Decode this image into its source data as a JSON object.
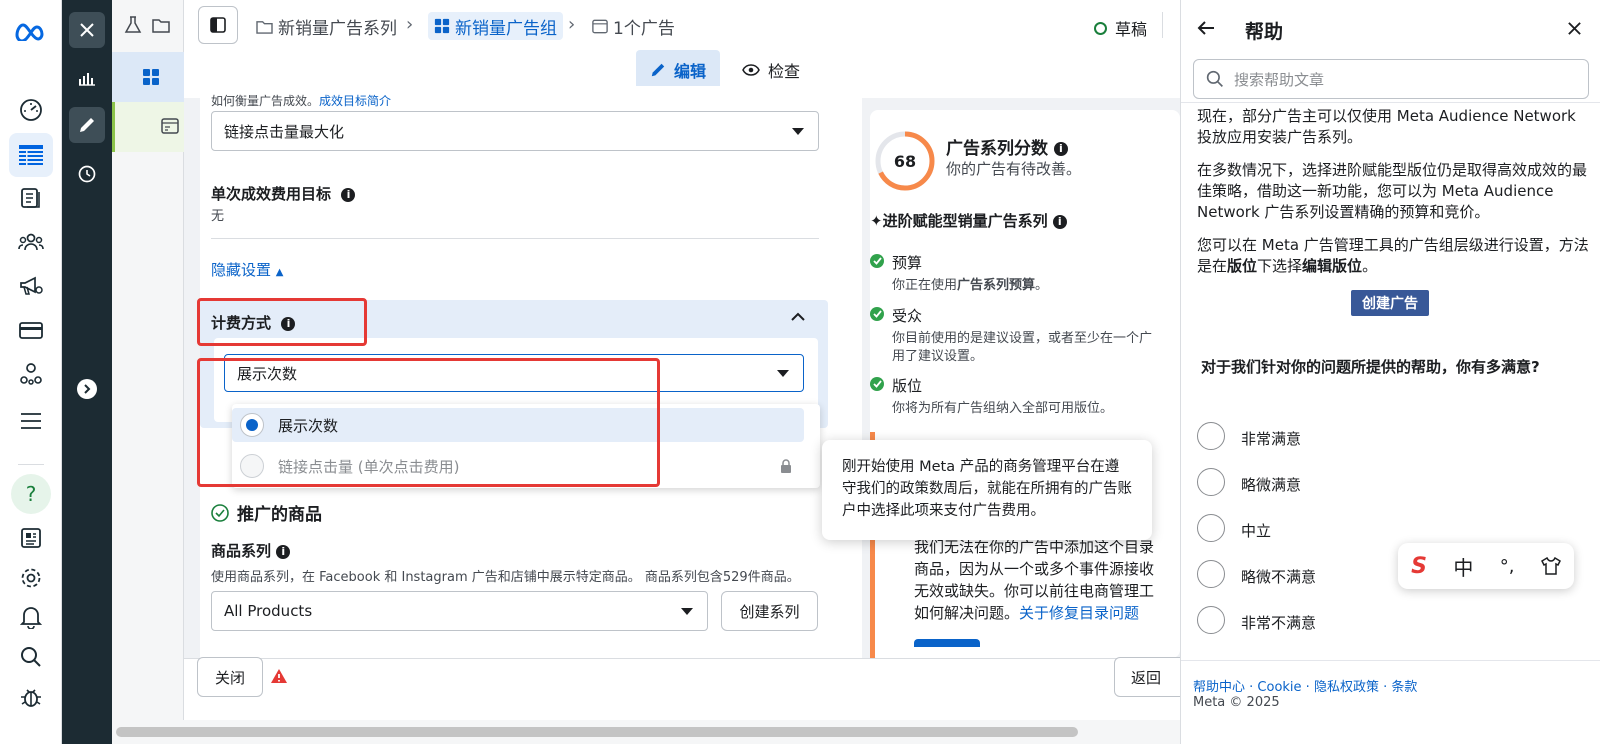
{
  "breadcrumb": {
    "campaign": "新销量广告系列",
    "adset": "新销量广告组",
    "ad": "1个广告"
  },
  "status": {
    "draft": "草稿"
  },
  "tabs": {
    "edit": "编辑",
    "review": "检查"
  },
  "form": {
    "cut_text": "如何衡量广告成效。",
    "cut_link": "成效目标简介",
    "optimization_value": "链接点击量最大化",
    "cost_goal_label": "单次成效费用目标",
    "cost_goal_value": "无",
    "hide_settings": "隐藏设置",
    "billing_label": "计费方式",
    "billing_value": "展示次数",
    "billing_options": [
      "展示次数",
      "链接点击量 (单次点击费用)"
    ],
    "promoted_products": "推广的商品",
    "catalog_label": "商品系列",
    "catalog_desc": "使用商品系列，在 Facebook 和 Instagram 广告和店铺中展示特定商品。 商品系列包含529件商品。",
    "catalog_value": "All Products",
    "create_set": "创建系列"
  },
  "score": {
    "value": "68",
    "title": "广告系列分数",
    "subtitle": "你的广告有待改善。",
    "advantage_title": "✦进阶赋能型销量广告系列",
    "items": [
      {
        "title": "预算",
        "desc_a": "你正在使用",
        "desc_b": "广告系列预算",
        "desc_c": "。"
      },
      {
        "title": "受众",
        "desc_a": "你目前使用的是建议设置，或者至少在一个广",
        "desc_b": "用了建议设置。",
        "desc_c": ""
      },
      {
        "title": "版位",
        "desc_a": "你将为所有广告组纳入全部可用版位。",
        "desc_b": "",
        "desc_c": ""
      }
    ],
    "warn_lines": [
      "我们无法在你的广告中添加这个目录",
      "商品，因为从一个或多个事件源接收",
      "无效或缺失。你可以前往电商管理工",
      "如何解决问题。"
    ],
    "warn_link": "关于修复目录问题"
  },
  "tooltip": {
    "text": "刚开始使用 Meta 产品的商务管理平台在遵守我们的政策数周后，就能在所拥有的广告账户中选择此项来支付广告费用。"
  },
  "bottom": {
    "close": "关闭",
    "back": "返回"
  },
  "help": {
    "title": "帮助",
    "search_placeholder": "搜索帮助文章",
    "para1": "现在，部分广告主可以仅使用 Meta Audience Network 投放应用安装广告系列。",
    "para2": "在多数情况下，选择进阶赋能型版位仍是取得高效成效的最佳策略，借助这一新功能，您可以为 Meta Audience Network 广告系列设置精确的预算和竞价。",
    "para3a": "您可以在 Meta 广告管理工具的广告组层级进行设置，方法是在",
    "para3b": "版位",
    "para3c": "下选择",
    "para3d": "编辑版位",
    "para3e": "。",
    "create_ad": "创建广告",
    "survey_question": "对于我们针对你的问题所提供的帮助，你有多满意?",
    "options": [
      "非常满意",
      "略微满意",
      "中立",
      "略微不满意",
      "非常不满意"
    ],
    "footer_links": [
      "帮助中心",
      "Cookie",
      "隐私权政策",
      "条款"
    ],
    "copyright": "Meta © 2025"
  },
  "ime": {
    "lang": "中",
    "punct": "°,"
  },
  "colors": {
    "accent": "#0a63c9",
    "highlight": "#e53935",
    "score": "#f7894a",
    "dark_rail": "#1c2b33"
  }
}
